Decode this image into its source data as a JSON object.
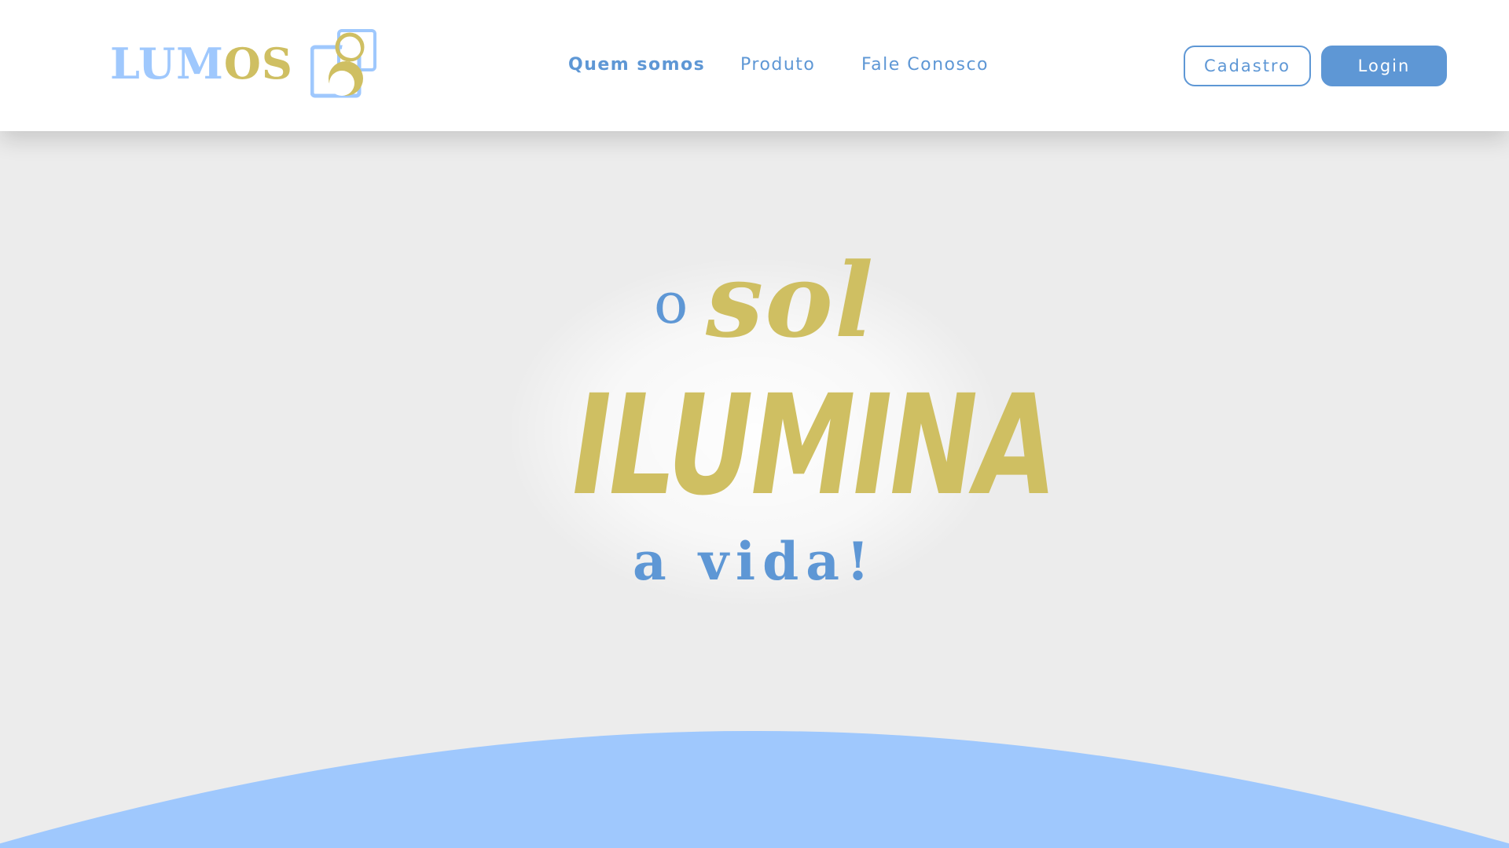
{
  "brand": {
    "name_part1": "LUM",
    "name_part2": "OS",
    "logo_icon": "lumos-mark-icon",
    "colors": {
      "blue": "#9fc8fd",
      "gold": "#cfbf62"
    }
  },
  "nav": {
    "items": [
      {
        "label": "Quem somos",
        "active": true
      },
      {
        "label": "Produto",
        "active": false
      },
      {
        "label": "Fale Conosco",
        "active": false
      }
    ]
  },
  "auth": {
    "signup_label": "Cadastro",
    "login_label": "Login"
  },
  "hero": {
    "line1_small": "o",
    "line1_script": "sol",
    "line2": "ILUMINA",
    "line3": "a vida!"
  },
  "theme": {
    "accent": "#5e97d5",
    "gold": "#cfbf62",
    "sky": "#9fc8fd",
    "background": "#ececec"
  }
}
